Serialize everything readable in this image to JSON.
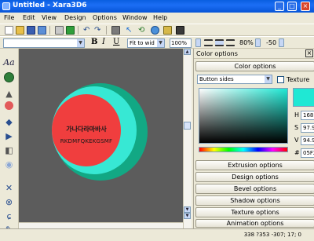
{
  "window": {
    "title": "Untitled - Xara3D6",
    "min_glyph": "_",
    "max_glyph": "□",
    "close_glyph": "×"
  },
  "menu": {
    "items": [
      "File",
      "Edit",
      "View",
      "Design",
      "Options",
      "Window",
      "Help"
    ]
  },
  "toolbar": {
    "fit_label": "Fit to wid",
    "zoom_value": "100%",
    "percent_value": "80%",
    "angle_value": "-50",
    "bold_label": "B",
    "italic_label": "I",
    "underline_label": "U"
  },
  "canvas": {
    "line1": "가나다라마바사",
    "line2": "RKDMFQKEKGSMF",
    "colors": {
      "background": "#5c5c5c",
      "face": "#f03e3e",
      "rim": "#37e8d4",
      "side": "#12a884"
    }
  },
  "panel": {
    "title": "Color options",
    "header_button": "Color options",
    "target_select": "Button sides",
    "texture_label": "Texture",
    "h_label": "H",
    "h_value": "168.8",
    "s_label": "S",
    "s_value": "97.9",
    "v_label": "V",
    "v_value": "94.9",
    "hex_label": "#",
    "hex_value": "05F2",
    "swatch_color": "#1fe8d4",
    "sections": [
      "Extrusion options",
      "Design options",
      "Bevel options",
      "Shadow options",
      "Texture options",
      "Animation options"
    ]
  },
  "status": {
    "text": "338 ?353 -307; 17; 0"
  }
}
